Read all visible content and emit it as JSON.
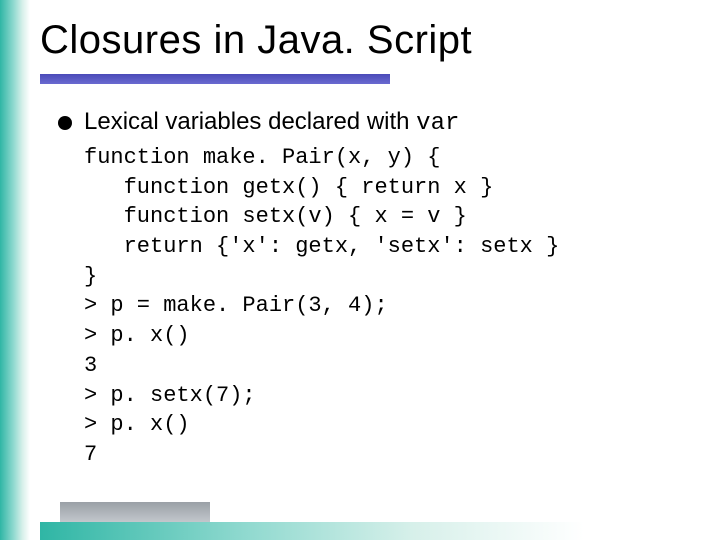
{
  "slide": {
    "title": "Closures in Java. Script",
    "bullet": {
      "prefix": "Lexical variables declared with ",
      "code_word": "var"
    },
    "code": "function make. Pair(x, y) {\n   function getx() { return x }\n   function setx(v) { x = v }\n   return {'x': getx, 'setx': setx }\n}\n> p = make. Pair(3, 4);\n> p. x()\n3\n> p. setx(7);\n> p. x()\n7"
  }
}
